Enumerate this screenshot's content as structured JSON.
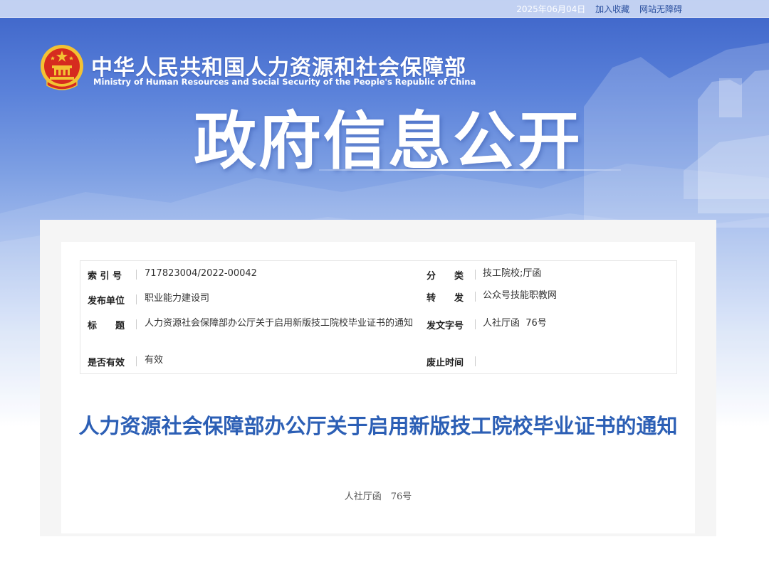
{
  "topbar": {
    "date": "2025年06月04日",
    "bookmark_label": "加入收藏",
    "accessibility_label": "网站无障碍"
  },
  "header": {
    "ministry_cn": "中华人民共和国人力资源和社会保障部",
    "ministry_en": "Ministry of Human Resources and Social Security of the People's Republic of China",
    "page_heading": "政府信息公开"
  },
  "meta": {
    "index_no": {
      "label": "索 引 号",
      "value": "717823004/2022-00042"
    },
    "category": {
      "label": "分　　类",
      "value": "技工院校;厅函"
    },
    "publisher": {
      "label": "发布单位",
      "value": "职业能力建设司"
    },
    "forward": {
      "label": "转　　发",
      "value": "公众号技能职教网"
    },
    "title": {
      "label": "标　　题",
      "value": "人力资源社会保障部办公厅关于启用新版技工院校毕业证书的通知"
    },
    "doc_no": {
      "label": "发文字号",
      "value": "人社厅函  76号"
    },
    "valid": {
      "label": "是否有效",
      "value": "有效"
    },
    "expire": {
      "label": "废止时间",
      "value": ""
    }
  },
  "document": {
    "title": "人力资源社会保障部办公厅关于启用新版技工院校毕业证书的通知",
    "number": "人社厅函　76号"
  },
  "colors": {
    "banner_blue": "#3c63c8",
    "title_blue": "#2c5fb5",
    "emblem_red": "#d62b1f",
    "emblem_gold": "#f3c233"
  }
}
